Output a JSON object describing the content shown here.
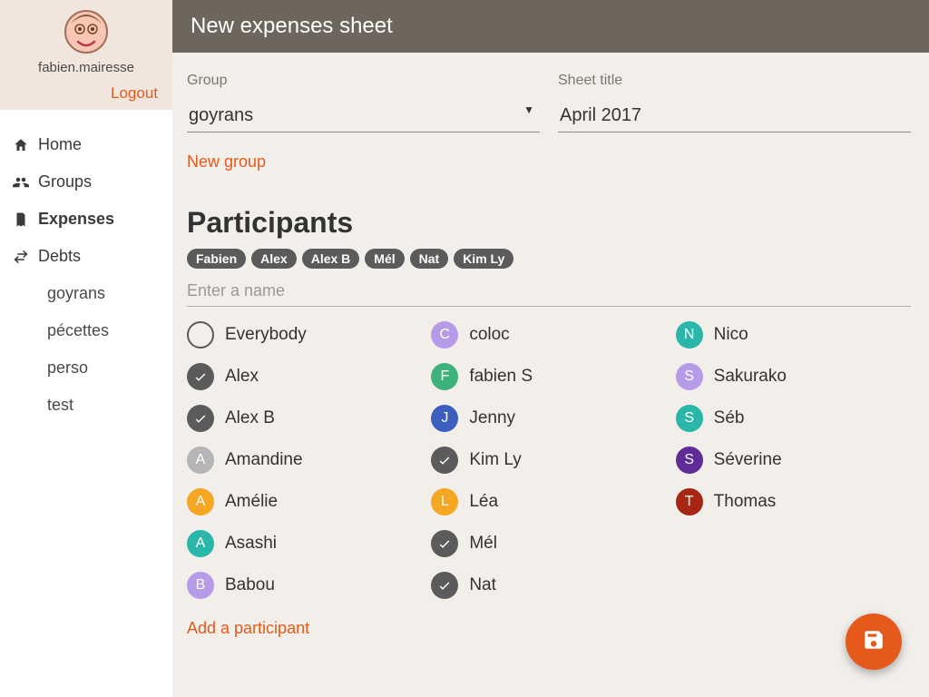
{
  "user": {
    "name": "fabien.mairesse",
    "logout_label": "Logout"
  },
  "nav": {
    "home": "Home",
    "groups": "Groups",
    "expenses": "Expenses",
    "debts": "Debts"
  },
  "debt_groups": [
    "goyrans",
    "pécettes",
    "perso",
    "test"
  ],
  "page_title": "New expenses sheet",
  "form": {
    "group_label": "Group",
    "group_value": "goyrans",
    "sheet_title_label": "Sheet title",
    "sheet_title_value": "April 2017",
    "new_group_label": "New group"
  },
  "participants": {
    "heading": "Participants",
    "selected": [
      "Fabien",
      "Alex",
      "Alex B",
      "Mél",
      "Nat",
      "Kim Ly"
    ],
    "name_placeholder": "Enter a name",
    "add_label": "Add a participant",
    "list": [
      {
        "label": "Everybody",
        "state": "ring",
        "letter": "",
        "color": ""
      },
      {
        "label": "Alex",
        "state": "checked",
        "letter": "",
        "color": ""
      },
      {
        "label": "Alex B",
        "state": "checked",
        "letter": "",
        "color": ""
      },
      {
        "label": "Amandine",
        "state": "letter",
        "letter": "A",
        "color": "#b5b5b5"
      },
      {
        "label": "Amélie",
        "state": "letter",
        "letter": "A",
        "color": "#f5a623"
      },
      {
        "label": "Asashi",
        "state": "letter",
        "letter": "A",
        "color": "#2ab7a9"
      },
      {
        "label": "Babou",
        "state": "letter",
        "letter": "B",
        "color": "#b89be8"
      },
      {
        "label": "coloc",
        "state": "letter",
        "letter": "C",
        "color": "#b89be8"
      },
      {
        "label": "fabien S",
        "state": "letter",
        "letter": "F",
        "color": "#3db27b"
      },
      {
        "label": "Jenny",
        "state": "letter",
        "letter": "J",
        "color": "#3a5fbf"
      },
      {
        "label": "Kim Ly",
        "state": "checked",
        "letter": "",
        "color": ""
      },
      {
        "label": "Léa",
        "state": "letter",
        "letter": "L",
        "color": "#f5a623"
      },
      {
        "label": "Mél",
        "state": "checked",
        "letter": "",
        "color": ""
      },
      {
        "label": "Nat",
        "state": "checked",
        "letter": "",
        "color": ""
      },
      {
        "label": "Nico",
        "state": "letter",
        "letter": "N",
        "color": "#2ab7a9"
      },
      {
        "label": "Sakurako",
        "state": "letter",
        "letter": "S",
        "color": "#b89be8"
      },
      {
        "label": "Séb",
        "state": "letter",
        "letter": "S",
        "color": "#2ab7a9"
      },
      {
        "label": "Séverine",
        "state": "letter",
        "letter": "S",
        "color": "#5e2b97"
      },
      {
        "label": "Thomas",
        "state": "letter",
        "letter": "T",
        "color": "#a52714"
      }
    ]
  }
}
